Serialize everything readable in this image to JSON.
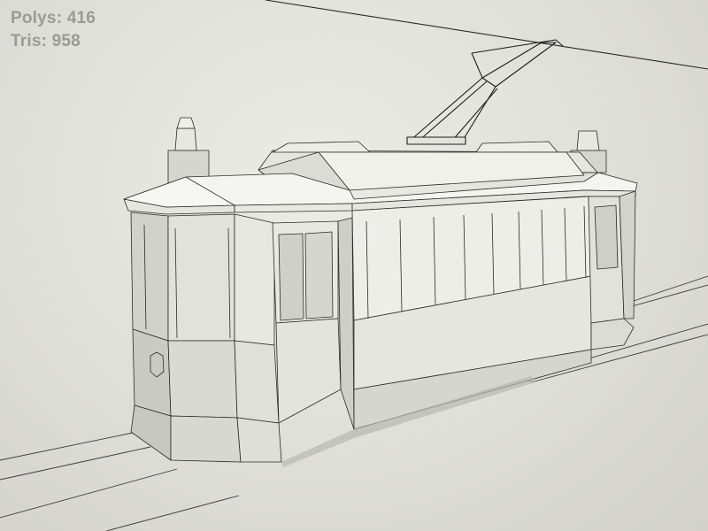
{
  "viewport": {
    "stats": {
      "polys_label": "Polys: 416",
      "tris_label": "Tris: 958"
    },
    "model_icon": "tram-wireframe-model",
    "colors": {
      "background": "#e3e3dd",
      "model_light": "#f2f2ee",
      "model_mid": "#dcdcd6",
      "model_dark": "#c4c4be",
      "wire": "#2a2a2a",
      "stats_text": "#9a9a96"
    }
  }
}
